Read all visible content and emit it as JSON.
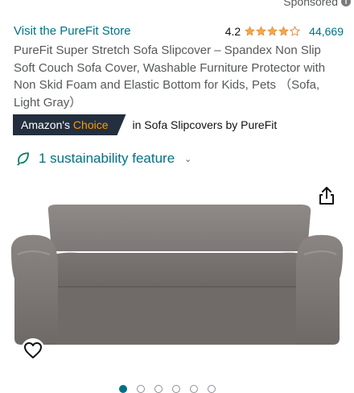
{
  "header": {
    "sponsored_label": "Sponsored",
    "info_icon": "info-icon"
  },
  "store": {
    "link_label": "Visit the PureFit Store"
  },
  "rating": {
    "value": "4.2",
    "stars": 4.2,
    "count": "44,669",
    "star_color": "#f3a847"
  },
  "product": {
    "title": "PureFit Super Stretch Sofa Slipcover – Spandex Non Slip Soft Couch Sofa Cover, Washable Furniture Protector with Non Skid Foam and Elastic Bottom for Kids, Pets （Sofa, Light Gray）"
  },
  "badge": {
    "prefix": "Amazon's",
    "accent": "Choice",
    "context": "in Sofa Slipcovers by PureFit",
    "badge_color": "#232f3e",
    "accent_color": "#ff9900"
  },
  "sustainability": {
    "label": "1 sustainability feature",
    "icon": "leaf-icon"
  },
  "gallery": {
    "image_name": "gray-sofa-slipcover-image",
    "share_icon": "share-icon",
    "wishlist_icon": "heart-icon",
    "total_images": 6,
    "active_index": 0
  },
  "colors": {
    "link": "#007185",
    "text": "#0f1111",
    "muted": "#565959"
  }
}
